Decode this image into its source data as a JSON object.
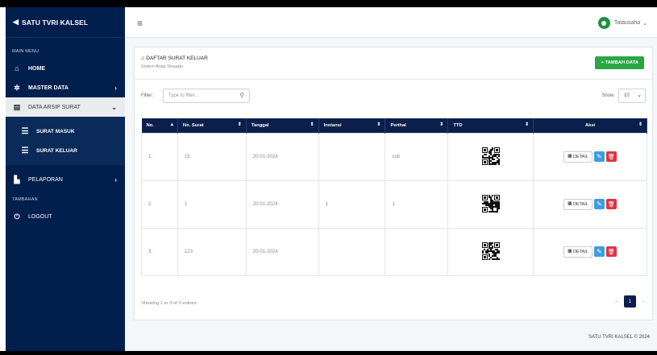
{
  "sidebar": {
    "brand": "SATU TVRI KALSEL",
    "main_menu_label": "MAIN MENU",
    "tambahan_label": "TAMBAHAN",
    "items": [
      {
        "label": "HOME"
      },
      {
        "label": "MASTER DATA"
      },
      {
        "label": "DATA ARSIP SURAT"
      },
      {
        "label": "PELAPORAN"
      },
      {
        "label": "LOGOUT"
      }
    ],
    "submenu": [
      {
        "label": "SURAT MASUK"
      },
      {
        "label": "SURAT KELUAR"
      }
    ]
  },
  "header": {
    "user_name": "Tatausaha"
  },
  "page": {
    "title": "DAFTAR SURAT KELUAR",
    "subtitle": "Sistem Arsip Terpadu",
    "add_button": "TAMBAH DATA",
    "filter_label": "Filter:",
    "filter_placeholder": "Type to filter...",
    "show_label": "Show:",
    "show_value": "10"
  },
  "table": {
    "headers": [
      "No.",
      "No. Surat",
      "Tanggal",
      "Instansi",
      "Perihal",
      "TTD",
      "Aksi"
    ],
    "rows": [
      {
        "no": "1.",
        "no_surat": "15",
        "tanggal": "20-01-2024",
        "instansi": "",
        "perihal": "cuti"
      },
      {
        "no": "2.",
        "no_surat": "1",
        "tanggal": "20-01-2024",
        "instansi": "1",
        "perihal": "1"
      },
      {
        "no": "3.",
        "no_surat": "123",
        "tanggal": "20-01-2024",
        "instansi": "",
        "perihal": ""
      }
    ],
    "detail_label": "DETAIL"
  },
  "footer": {
    "showing": "Showing 1 to 3 of 3 entries",
    "current_page": "1",
    "copyright": "SATU TVRI KALSEL © 2024"
  },
  "colors": {
    "sidebar": "#001f4d",
    "add_button": "#28a745",
    "edit_button": "#3c9dde",
    "delete_button": "#e0343f"
  },
  "icons": [
    "arrow-left-icon",
    "home-icon",
    "gear-icon",
    "document-icon",
    "list-icon",
    "report-icon",
    "power-icon",
    "menu-icon",
    "search-icon",
    "qr-icon",
    "edit-icon",
    "trash-icon"
  ]
}
